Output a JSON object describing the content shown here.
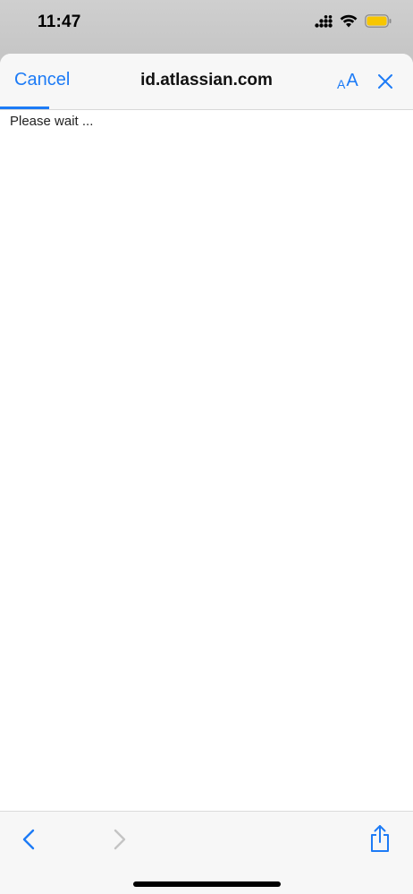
{
  "status_bar": {
    "time": "11:47",
    "battery_color": "#f7c600"
  },
  "nav": {
    "cancel_label": "Cancel",
    "domain": "id.atlassian.com",
    "text_size_small": "A",
    "text_size_large": "A",
    "accent_color": "#1d7bf6",
    "load_progress": 0.12
  },
  "content": {
    "message": "Please wait ..."
  },
  "toolbar": {
    "back_enabled": true,
    "forward_enabled": false
  }
}
